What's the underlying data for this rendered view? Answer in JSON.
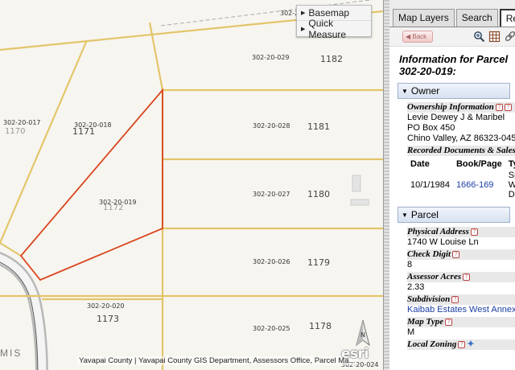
{
  "map": {
    "menu": [
      {
        "label": "Basemap"
      },
      {
        "label": "Quick Measure"
      }
    ],
    "parcels": [
      {
        "id": "302-2",
        "address": ""
      },
      {
        "id": "302-20-029",
        "address": "1182"
      },
      {
        "id": "302-20-017",
        "address": "1170"
      },
      {
        "id": "302-20-018",
        "address": "1171"
      },
      {
        "id": "302-20-028",
        "address": "1181"
      },
      {
        "id": "302-20-019",
        "address": "1172"
      },
      {
        "id": "302-20-027",
        "address": "1180"
      },
      {
        "id": "302-20-026",
        "address": "1179"
      },
      {
        "id": "302-20-020",
        "address": "1173"
      },
      {
        "id": "302-20-025",
        "address": "1178"
      },
      {
        "id": "302-20-024",
        "address": ""
      }
    ],
    "road_label": "MIS",
    "attribution": "Yavapai County | Yavapai County GIS Department, Assessors Office, Parcel Ma...",
    "logo": "esri",
    "north_label": "N",
    "selected_color": "#d9461f",
    "line_color": "#e3c56a"
  },
  "panel": {
    "tabs": [
      {
        "label": "Map Layers"
      },
      {
        "label": "Search"
      },
      {
        "label": "Results"
      }
    ],
    "back_label": "Back",
    "title": "Information for Parcel 302-20-019:",
    "owner": {
      "header": "Owner",
      "ownership_label": "Ownership Information",
      "owner_name": "Levie Dewey J & Maribel",
      "address1": "PO Box 450",
      "address2": "Chino Valley, AZ  86323-0450",
      "recorded_label": "Recorded Documents & Sales",
      "doc_headers": [
        "Date",
        "Book/Page",
        "Type"
      ],
      "doc_row": {
        "date": "10/1/1984",
        "book": "1666-169",
        "type_lines": [
          "Sp",
          "Wa",
          "D"
        ]
      }
    },
    "parcel": {
      "header": "Parcel",
      "physical_address_label": "Physical Address",
      "physical_address": "1740 W Louise Ln",
      "check_digit_label": "Check Digit",
      "check_digit": "8",
      "acres_label": "Assessor Acres",
      "acres": "2.33",
      "subdivision_label": "Subdivision",
      "subdivision": "Kaibab Estates West Annex #",
      "map_type_label": "Map Type",
      "map_type": "M",
      "zoning_label": "Local Zoning"
    }
  }
}
